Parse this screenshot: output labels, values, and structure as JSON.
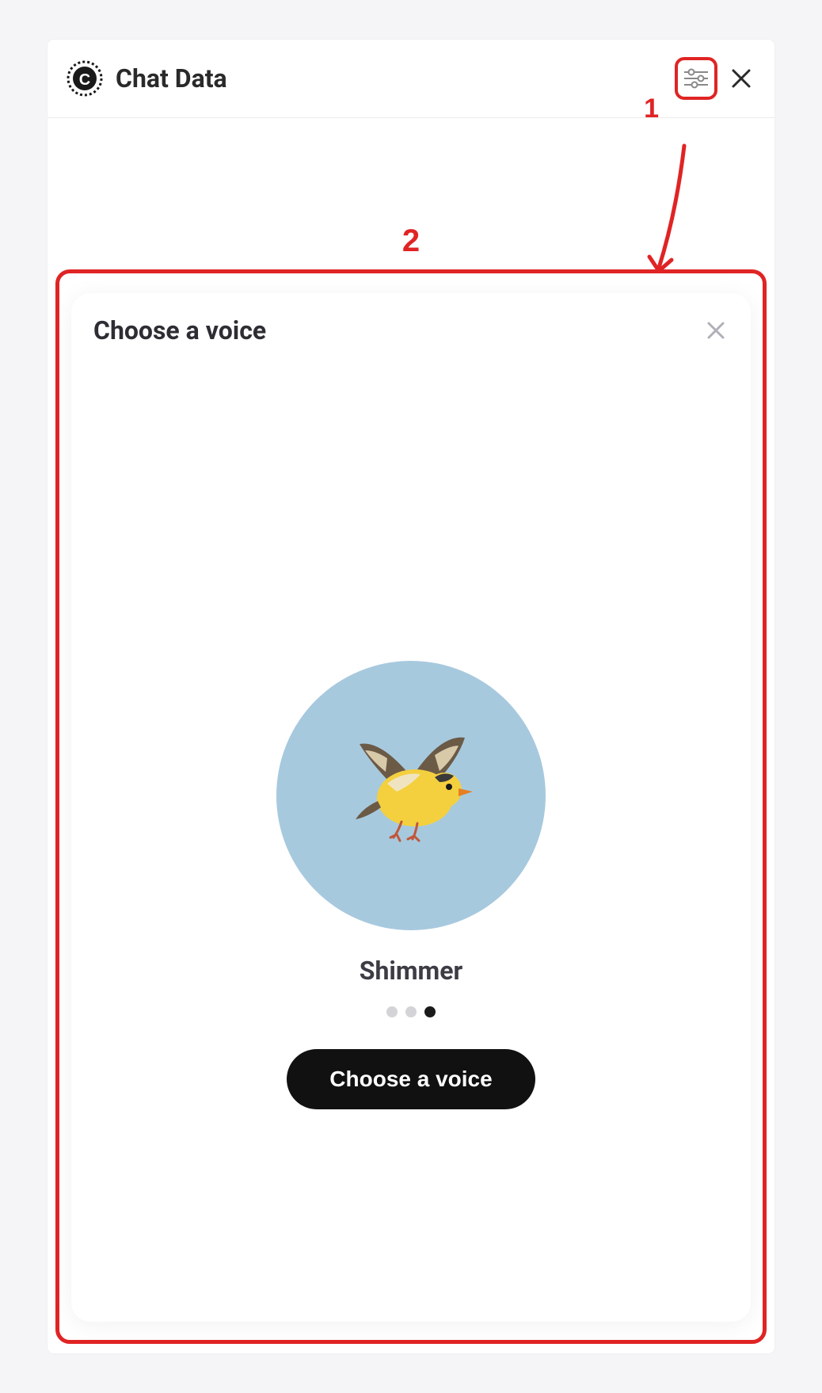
{
  "header": {
    "app_title": "Chat Data",
    "settings_icon": "settings-sliders-icon",
    "close_icon": "close-icon"
  },
  "annotations": {
    "label_1": "1",
    "label_2": "2",
    "color": "#e02424"
  },
  "voice_card": {
    "title": "Choose a voice",
    "close_icon": "close-icon",
    "avatar": {
      "bg_color": "#a7c9de",
      "image_name": "bird-icon"
    },
    "voice_name": "Shimmer",
    "pagination": {
      "total": 3,
      "active_index": 2
    },
    "action_button_label": "Choose a voice"
  }
}
